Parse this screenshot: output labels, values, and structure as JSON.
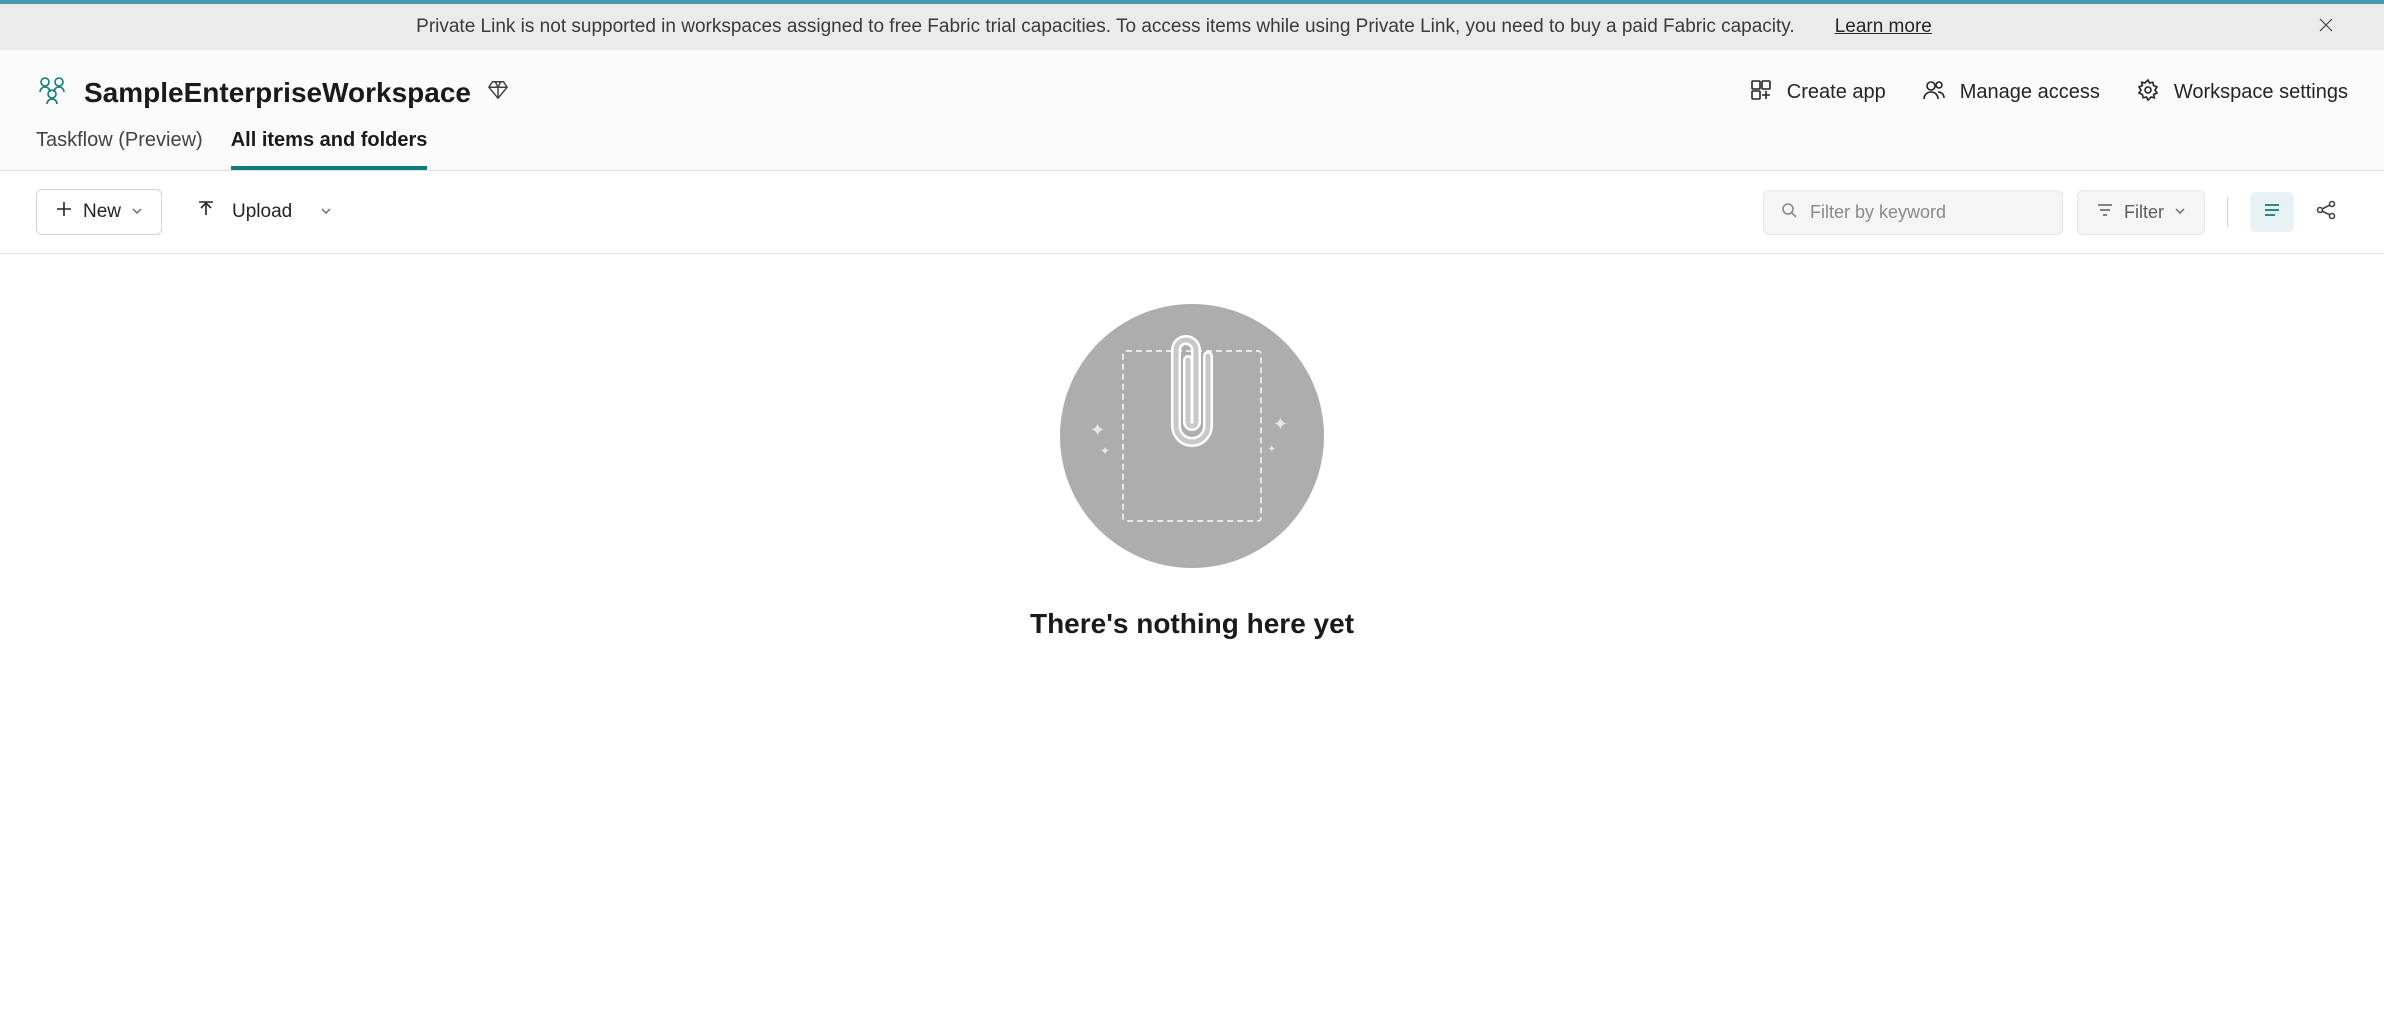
{
  "notification": {
    "message": "Private Link is not supported in workspaces assigned to free Fabric trial capacities. To access items while using Private Link, you need to buy a paid Fabric capacity.",
    "learn_more": "Learn more"
  },
  "workspace": {
    "name": "SampleEnterpriseWorkspace"
  },
  "header_actions": {
    "create_app": "Create app",
    "manage_access": "Manage access",
    "workspace_settings": "Workspace settings"
  },
  "tabs": {
    "taskflow": "Taskflow (Preview)",
    "all_items": "All items and folders"
  },
  "toolbar": {
    "new_label": "New",
    "upload_label": "Upload",
    "filter_placeholder": "Filter by keyword",
    "filter_button": "Filter"
  },
  "empty_state": {
    "title": "There's nothing here yet"
  }
}
